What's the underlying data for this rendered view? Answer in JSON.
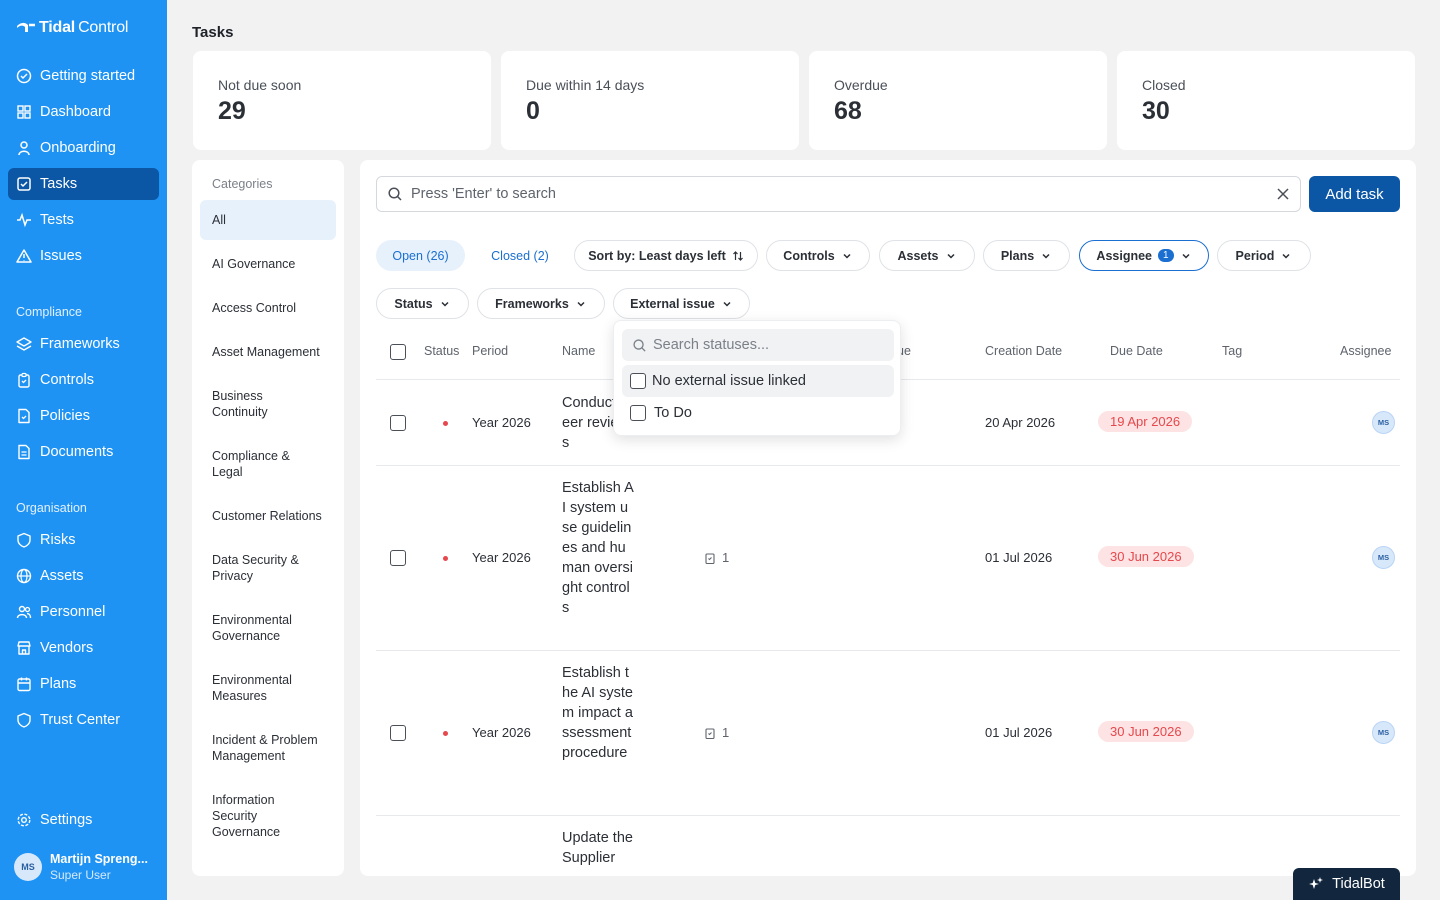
{
  "brand": {
    "name_bold": "Tidal",
    "name_light": "Control"
  },
  "sidebar": {
    "items": [
      {
        "label": "Getting started",
        "icon": "check-circle-icon"
      },
      {
        "label": "Dashboard",
        "icon": "grid-icon"
      },
      {
        "label": "Onboarding",
        "icon": "person-icon"
      },
      {
        "label": "Tasks",
        "icon": "checkbox-icon",
        "active": true
      },
      {
        "label": "Tests",
        "icon": "activity-icon"
      },
      {
        "label": "Issues",
        "icon": "warning-icon"
      }
    ],
    "compliance_label": "Compliance",
    "compliance": [
      {
        "label": "Frameworks",
        "icon": "layers-icon"
      },
      {
        "label": "Controls",
        "icon": "clipboard-icon"
      },
      {
        "label": "Policies",
        "icon": "document-icon"
      },
      {
        "label": "Documents",
        "icon": "file-icon"
      }
    ],
    "organisation_label": "Organisation",
    "organisation": [
      {
        "label": "Risks",
        "icon": "shield-icon"
      },
      {
        "label": "Assets",
        "icon": "globe-icon"
      },
      {
        "label": "Personnel",
        "icon": "people-icon"
      },
      {
        "label": "Vendors",
        "icon": "store-icon"
      },
      {
        "label": "Plans",
        "icon": "calendar-icon"
      },
      {
        "label": "Trust Center",
        "icon": "shield-check-icon"
      }
    ],
    "settings": "Settings",
    "user": {
      "initials": "MS",
      "name": "Martijn Spreng...",
      "role": "Super User"
    }
  },
  "page": {
    "title": "Tasks"
  },
  "stats": [
    {
      "label": "Not due soon",
      "value": "29"
    },
    {
      "label": "Due within 14 days",
      "value": "0"
    },
    {
      "label": "Overdue",
      "value": "68"
    },
    {
      "label": "Closed",
      "value": "30"
    }
  ],
  "categories": {
    "heading": "Categories",
    "items": [
      "All",
      "AI Governance",
      "Access Control",
      "Asset Management",
      "Business Continuity",
      "Compliance & Legal",
      "Customer Relations",
      "Data Security & Privacy",
      "Environmental Governance",
      "Environmental Measures",
      "Incident & Problem Management",
      "Information Security Governance"
    ]
  },
  "search": {
    "placeholder": "Press 'Enter' to search"
  },
  "add_task": "Add task",
  "tabs": {
    "open": "Open (26)",
    "closed": "Closed (2)"
  },
  "filters": {
    "sort": "Sort by: Least days left",
    "controls": "Controls",
    "assets": "Assets",
    "plans": "Plans",
    "assignee": "Assignee",
    "assignee_count": "1",
    "period": "Period",
    "status": "Status",
    "frameworks": "Frameworks",
    "external_issue": "External issue"
  },
  "table": {
    "headers": {
      "status": "Status",
      "period": "Period",
      "name": "Name",
      "issue_partial": "ue",
      "creation": "Creation Date",
      "due": "Due Date",
      "tag": "Tag",
      "assignee": "Assignee"
    },
    "rows": [
      {
        "period": "Year 2026",
        "name": "Conduct peer reviews",
        "controls": "",
        "created": "20 Apr 2026",
        "due": "19 Apr 2026",
        "assignee": "MS"
      },
      {
        "period": "Year 2026",
        "name": "Establish AI system use guidelines and human oversight controls",
        "controls": "1",
        "created": "01 Jul 2026",
        "due": "30 Jun 2026",
        "assignee": "MS"
      },
      {
        "period": "Year 2026",
        "name": "Establish the AI system impact assessment procedure",
        "controls": "1",
        "created": "01 Jul 2026",
        "due": "30 Jun 2026",
        "assignee": "MS"
      },
      {
        "period": "",
        "name": "Update the Supplier",
        "controls": "",
        "created": "",
        "due": "",
        "assignee": ""
      }
    ]
  },
  "dropdown": {
    "placeholder": "Search statuses...",
    "options": [
      "No external issue linked",
      "To Do"
    ]
  },
  "tidalbot": "TidalBot",
  "colors": {
    "sidebar": "#1f93f4",
    "active": "#0b56a5",
    "overdue": "#e5484d"
  }
}
